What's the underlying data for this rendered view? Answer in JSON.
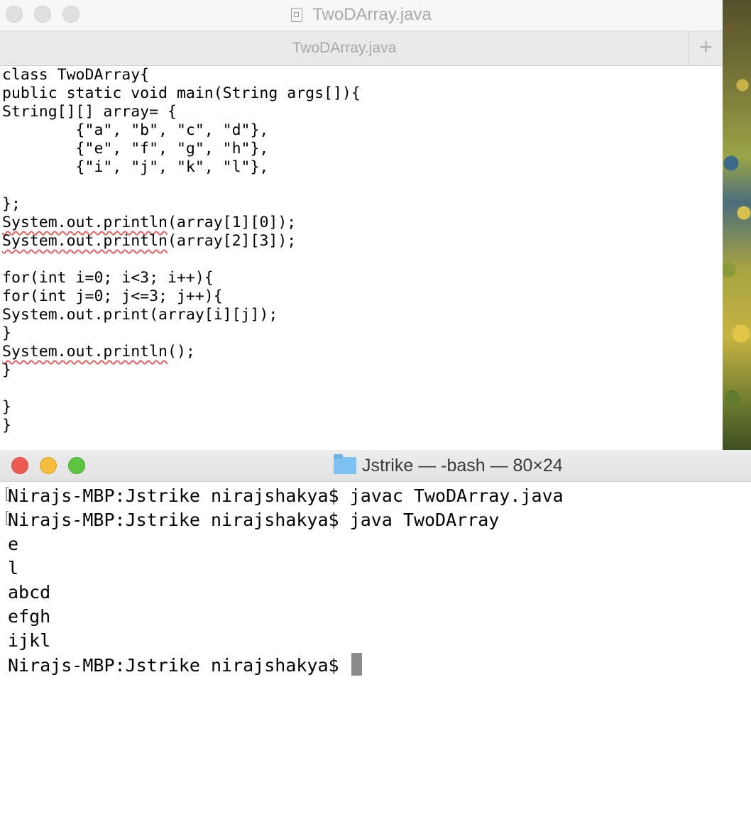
{
  "editor": {
    "window_title": "TwoDArray.java",
    "tab_label": "TwoDArray.java",
    "new_tab_symbol": "+",
    "code_lines": [
      {
        "text": "class TwoDArray{"
      },
      {
        "text": "public static void main(String args[]){"
      },
      {
        "text": "String[][] array= {"
      },
      {
        "text": "        {\"a\", \"b\", \"c\", \"d\"},"
      },
      {
        "text": "        {\"e\", \"f\", \"g\", \"h\"},"
      },
      {
        "text": "        {\"i\", \"j\", \"k\", \"l\"},"
      },
      {
        "text": ""
      },
      {
        "text": "};"
      },
      {
        "squiggle": "System.out.println",
        "rest": "(array[1][0]);"
      },
      {
        "squiggle": "System.out.println",
        "rest": "(array[2][3]);"
      },
      {
        "text": ""
      },
      {
        "text": "for(int i=0; i<3; i++){"
      },
      {
        "text": "for(int j=0; j<=3; j++){"
      },
      {
        "text": "System.out.print(array[i][j]);"
      },
      {
        "text": "}"
      },
      {
        "squiggle": "System.out.println",
        "rest": "();"
      },
      {
        "text": "}"
      },
      {
        "text": ""
      },
      {
        "text": "}"
      },
      {
        "text": "}"
      }
    ]
  },
  "terminal": {
    "window_title": "Jstrike — -bash — 80×24",
    "lines": [
      "Nirajs-MBP:Jstrike nirajshakya$ javac TwoDArray.java",
      "Nirajs-MBP:Jstrike nirajshakya$ java TwoDArray",
      "e",
      "l",
      "abcd",
      "efgh",
      "ijkl",
      "Nirajs-MBP:Jstrike nirajshakya$ "
    ],
    "bracket_marker": "["
  },
  "colors": {
    "close": "#ee5a52",
    "minimize": "#f4bd3b",
    "zoom": "#5dc542",
    "spellcheck_underline": "#e86060"
  }
}
